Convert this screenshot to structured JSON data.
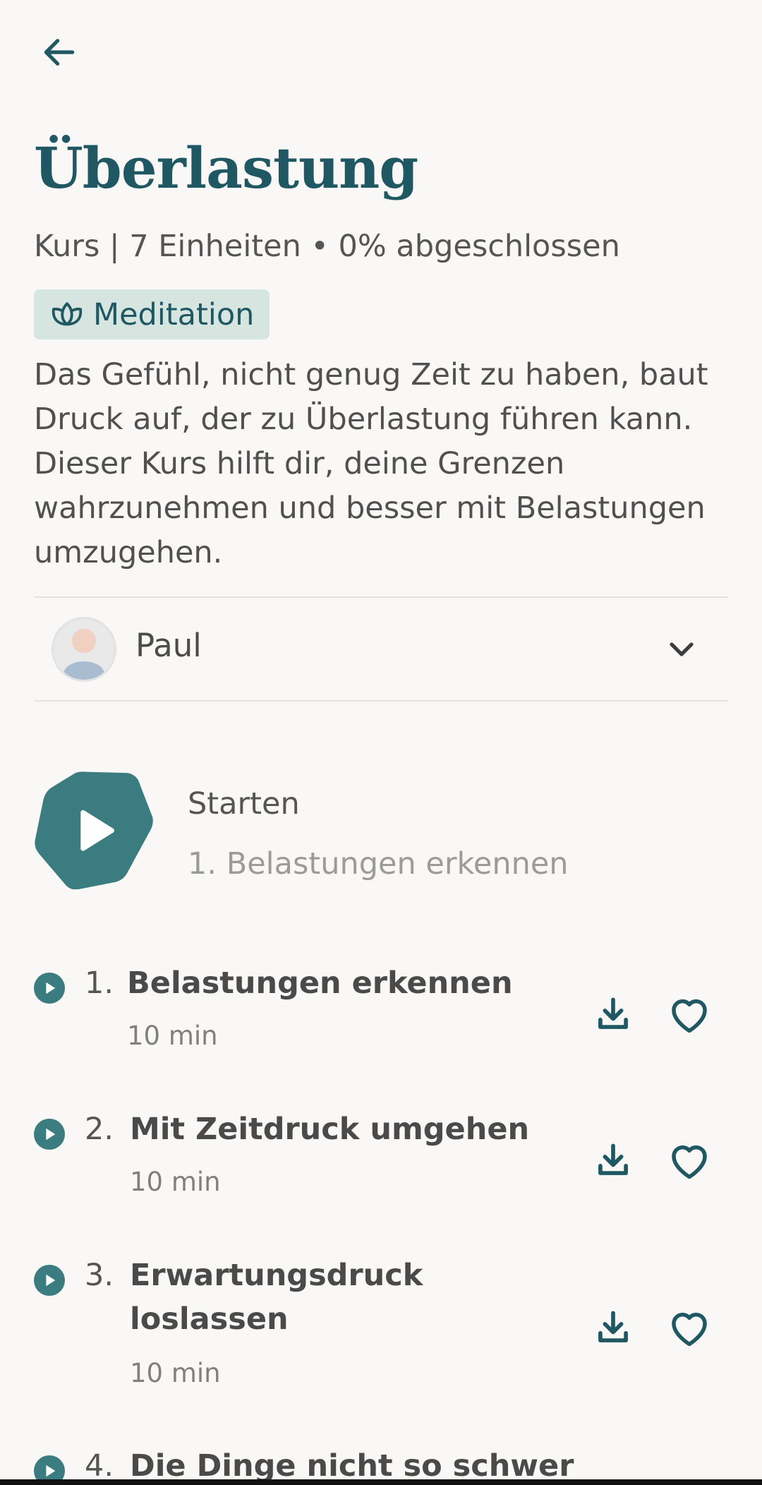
{
  "header": {
    "back_icon": "arrow-left-icon"
  },
  "course": {
    "title": "Überlastung",
    "meta": "Kurs | 7 Einheiten • 0% abgeschlossen",
    "badge": "Meditation",
    "badge_icon": "lotus-icon",
    "description": "Das Gefühl, nicht genug Zeit zu haben, baut Druck auf, der zu Überlastung führen kann. Dieser Kurs hilft dir, deine Grenzen wahrzunehmen und besser mit Belastungen umzugehen."
  },
  "teacher": {
    "name": "Paul",
    "dropdown_icon": "chevron-down-icon"
  },
  "start": {
    "label": "Starten",
    "next_session": "1. Belastungen erkennen",
    "icon": "play-icon"
  },
  "sessions": [
    {
      "num": "1.",
      "title": "Belastungen erkennen",
      "duration": "10 min"
    },
    {
      "num": "2.",
      "title": "Mit Zeitdruck umgehen",
      "duration": "10 min"
    },
    {
      "num": "3.",
      "title_line1": "Erwartungsdruck",
      "title_line2": "loslassen",
      "duration": "10 min"
    },
    {
      "num": "4.",
      "title": "Die Dinge nicht so schwer"
    }
  ],
  "colors": {
    "accent": "#3a7c80",
    "title": "#1f5863",
    "badge_bg": "#d7e5e1",
    "background": "#f9f8f7"
  }
}
